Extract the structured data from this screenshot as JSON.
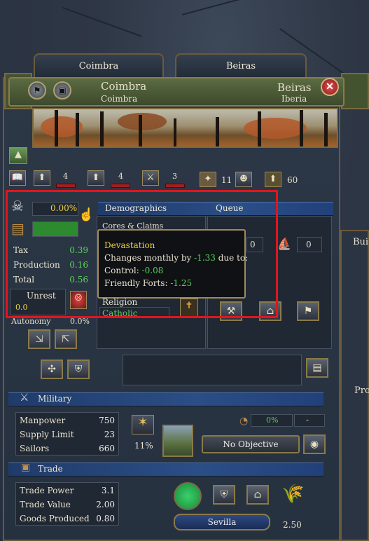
{
  "tabs": {
    "left": "Coimbra",
    "right": "Beiras"
  },
  "banner": {
    "province_name": "Coimbra",
    "province_sub": "Coimbra",
    "area_name": "Beiras",
    "area_sub": "Iberia"
  },
  "dev_stats": {
    "tax_dev": "4",
    "production_dev": "4",
    "manpower_dev": "3",
    "trade_goods_value": "11",
    "development_total": "60"
  },
  "economy": {
    "devastation_value": "0.00%",
    "tax_label": "Tax",
    "tax_value": "0.39",
    "production_label": "Production",
    "production_value": "0.16",
    "total_label": "Total",
    "total_value": "0.56",
    "unrest_label": "Unrest",
    "unrest_value": "0.0",
    "autonomy_label": "Autonomy",
    "autonomy_value": "0.0%"
  },
  "demographics": {
    "tab_demographics": "Demographics",
    "tab_queue": "Queue",
    "cores_label": "Cores & Claims",
    "religion_label": "Religion",
    "religion_value": "Catholic",
    "queue_count_1": "0",
    "queue_count_2": "0"
  },
  "tooltip": {
    "title": "Devastation",
    "line1_prefix": "Changes monthly by ",
    "line1_value": "-1.33",
    "line1_suffix": " due to:",
    "line2_label": "Control: ",
    "line2_value": "-0.08",
    "line3_label": "Friendly Forts: ",
    "line3_value": "-1.25"
  },
  "military": {
    "header": "Military",
    "manpower_label": "Manpower",
    "manpower_value": "750",
    "supply_label": "Supply Limit",
    "supply_value": "23",
    "sailors_label": "Sailors",
    "sailors_value": "660",
    "fort_percent": "11%",
    "progress_value": "0%",
    "dash": "-",
    "objective": "No Objective"
  },
  "trade": {
    "header": "Trade",
    "power_label": "Trade Power",
    "power_value": "3.1",
    "value_label": "Trade Value",
    "value_value": "2.00",
    "goods_label": "Goods Produced",
    "goods_value": "0.80",
    "node": "Sevilla",
    "goods_price": "2.50"
  },
  "right_panel": {
    "buildings_label": "Bui",
    "prod_label": "Pro"
  },
  "colors": {
    "highlight": "#e0161e",
    "positive": "#5ad05a",
    "negative_tooltip": "#5ad05a",
    "gold": "#f0d040"
  }
}
